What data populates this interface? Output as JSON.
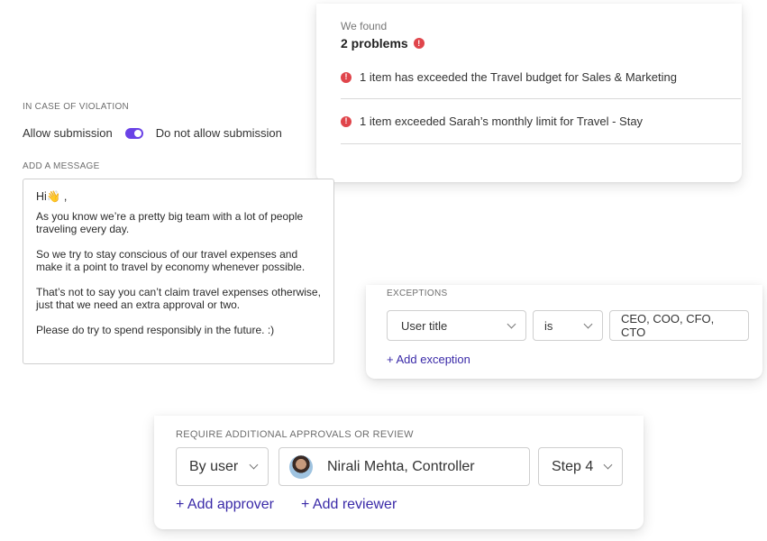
{
  "problems": {
    "found_label": "We found",
    "count_label": "2 problems",
    "items": [
      {
        "text": "1 item has exceeded the Travel budget for Sales & Marketing"
      },
      {
        "text": "1 item exceeded Sarah’s monthly limit for Travel - Stay"
      }
    ]
  },
  "violation": {
    "section_label": "IN CASE OF VIOLATION",
    "allow_label": "Allow submission",
    "disallow_label": "Do not allow submission",
    "toggle_on": true
  },
  "message": {
    "section_label": "ADD A MESSAGE",
    "greeting": "Hi👋 ,",
    "paragraphs": [
      "As you know we’re a pretty big team with a lot of people traveling every day.",
      "So we try to stay conscious of our travel expenses and make it a point to travel by economy whenever possible.",
      "That’s not to say you can’t claim travel expenses otherwise, just that we need an extra approval or two.",
      "Please do try to spend responsibly in the future. :)"
    ]
  },
  "exceptions": {
    "section_label": "EXCEPTIONS",
    "field": "User title",
    "operator": "is",
    "value": "CEO, COO, CFO, CTO",
    "add_label": "+ Add exception"
  },
  "approvals": {
    "section_label": "REQUIRE ADDITIONAL APPROVALS OR REVIEW",
    "type": "By user",
    "user": "Nirali Mehta, Controller",
    "step": "Step 4",
    "add_approver_label": "+ Add approver",
    "add_reviewer_label": "+ Add reviewer"
  },
  "colors": {
    "accent": "#6a42e6",
    "link": "#3a2aa8",
    "alert": "#e0454b"
  }
}
